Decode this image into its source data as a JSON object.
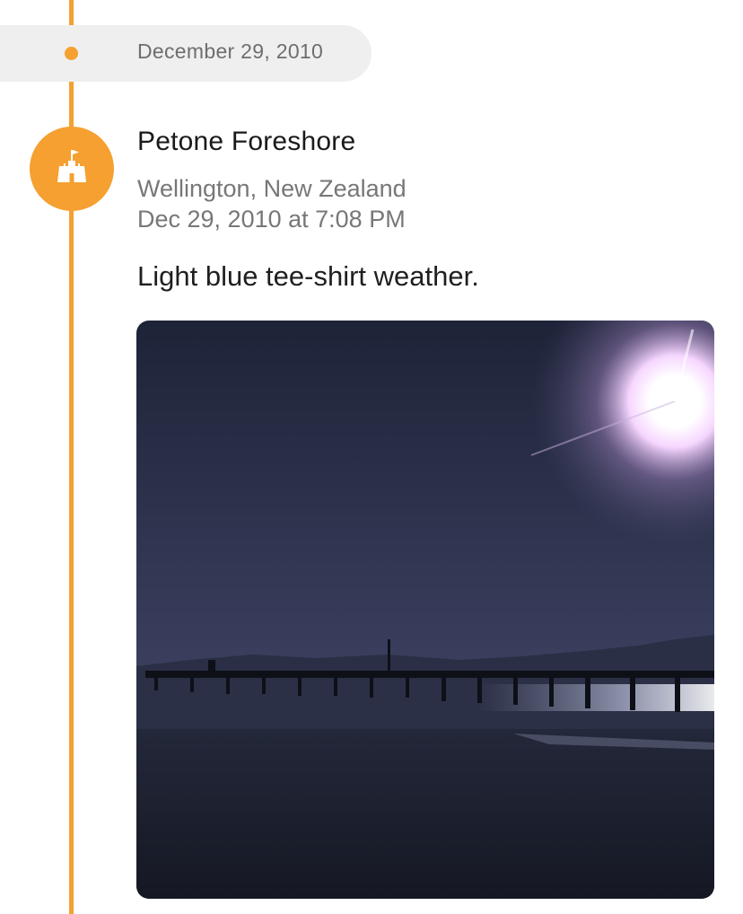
{
  "timeline": {
    "date_header": "December 29, 2010"
  },
  "entry": {
    "icon": "sandcastle-icon",
    "title": "Petone Foreshore",
    "location": "Wellington, New Zealand",
    "datetime": "Dec 29, 2010 at 7:08 PM",
    "caption": "Light blue tee-shirt weather."
  },
  "colors": {
    "accent": "#f5a030",
    "pill_bg": "#efefef"
  }
}
